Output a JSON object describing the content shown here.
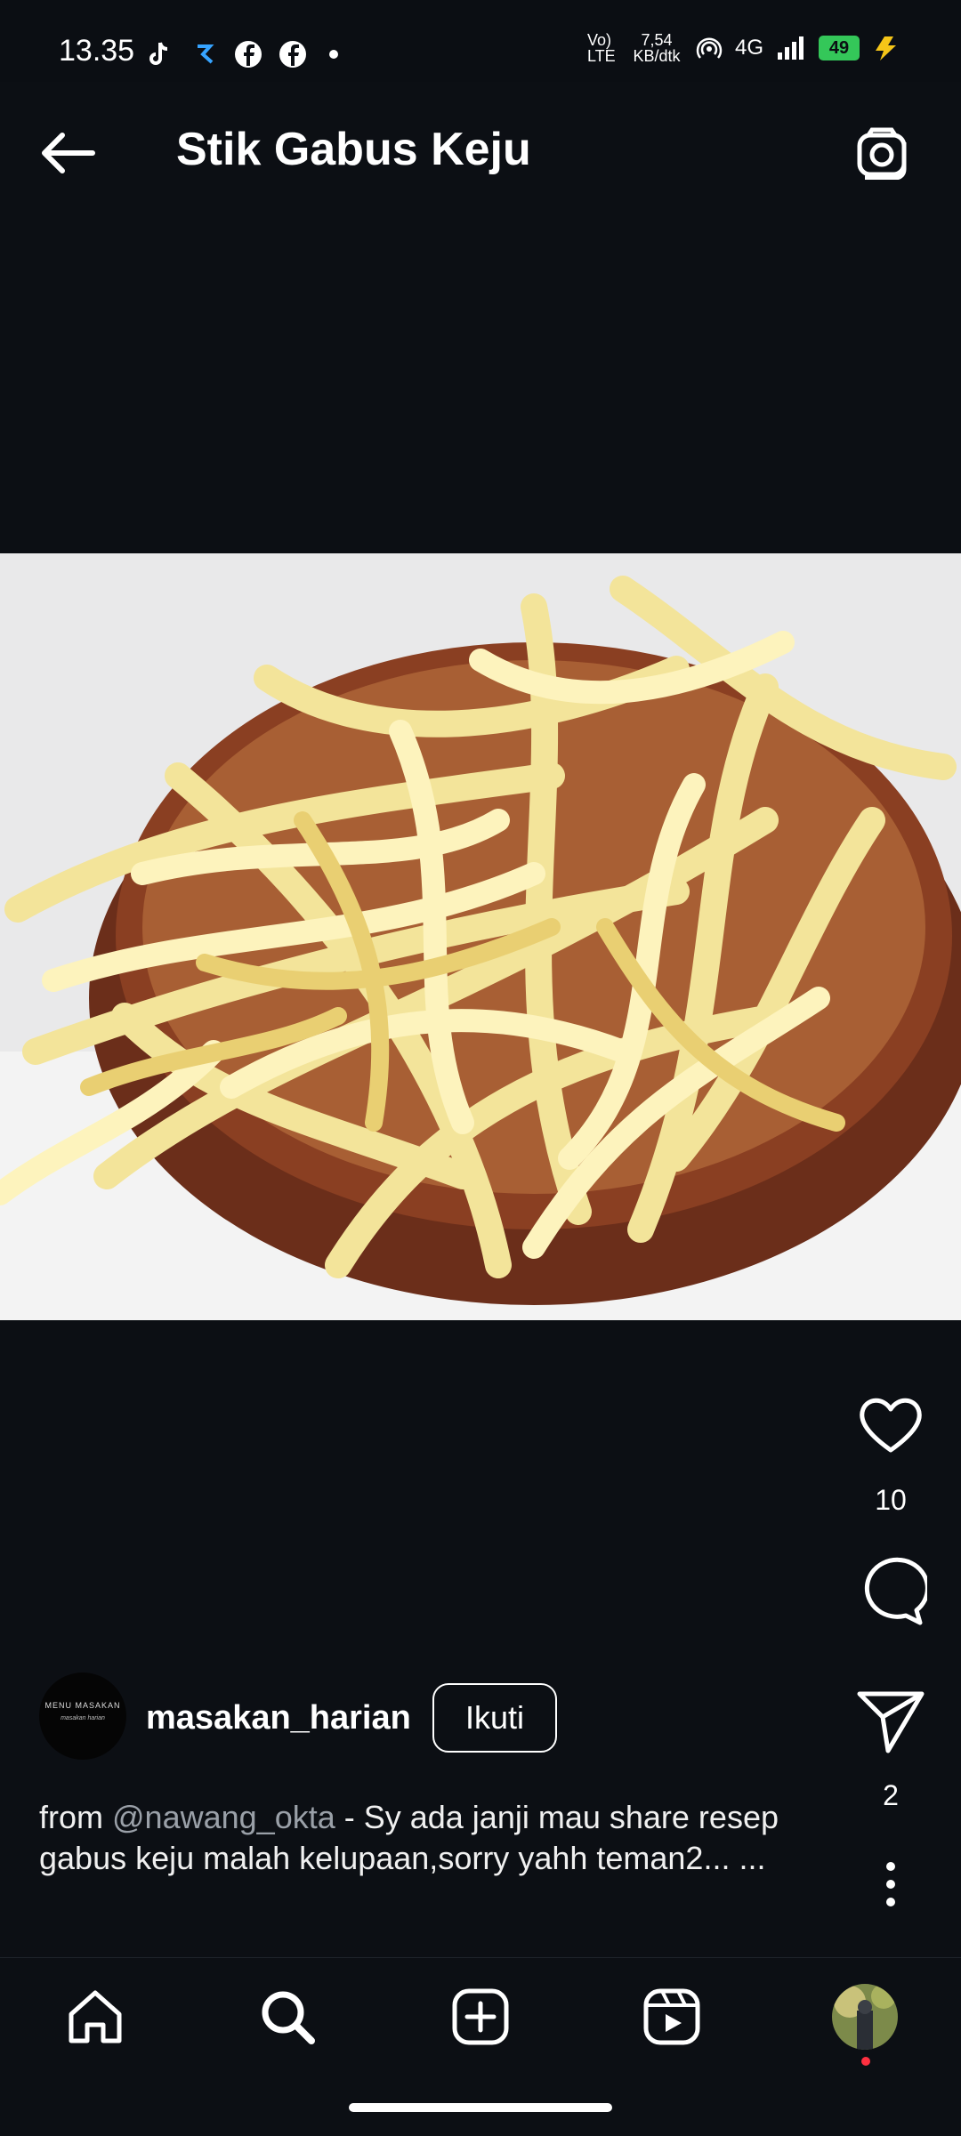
{
  "status_bar": {
    "time": "13.35",
    "net_lte": "Vo) LTE",
    "speed": "7,54 KB/dtk",
    "network": "4G",
    "battery": "49"
  },
  "header": {
    "title": "Stik Gabus Keju"
  },
  "actions": {
    "likes": "10",
    "shares": "2"
  },
  "author": {
    "username": "masakan_harian",
    "avatar_text": "MENU MASAKAN",
    "avatar_sub": "masakan harian",
    "follow_label": "Ikuti"
  },
  "caption": {
    "prefix": "from ",
    "mention": "@nawang_okta",
    "text": " -  Sy ada janji mau share resep gabus keju malah kelupaan,sorry yahh teman2... ",
    "more": "..."
  },
  "nav": {
    "items": [
      "home-icon",
      "search-icon",
      "create-icon",
      "reels-icon",
      "profile-avatar"
    ]
  },
  "colors": {
    "background": "#0c0f14",
    "accent_notification": "#ff3040",
    "battery": "#34c759"
  }
}
